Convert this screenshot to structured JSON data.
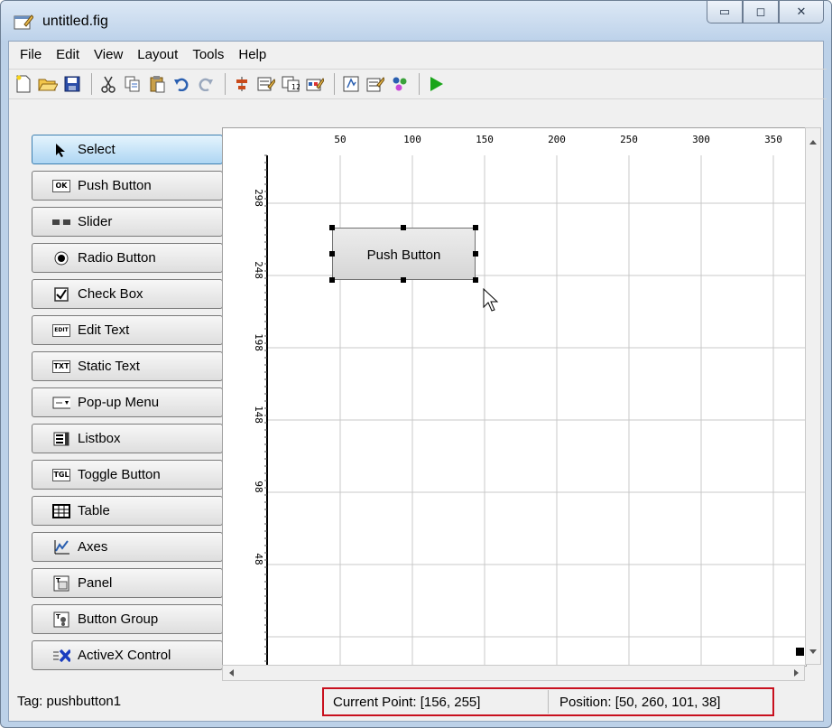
{
  "window": {
    "title": "untitled.fig",
    "min_glyph": "▭",
    "max_glyph": "◻",
    "close_glyph": "✕"
  },
  "menu": [
    "File",
    "Edit",
    "View",
    "Layout",
    "Tools",
    "Help"
  ],
  "toolbar_icons": [
    "new-icon",
    "open-icon",
    "save-icon",
    "sep",
    "cut-icon",
    "copy-icon",
    "paste-icon",
    "undo-icon",
    "redo-icon",
    "sep",
    "align-icon",
    "menu-editor-icon",
    "tab-order-icon",
    "toolbar-editor-icon",
    "sep",
    "mfile-editor-icon",
    "property-inspector-icon",
    "object-browser-icon",
    "sep",
    "run-icon"
  ],
  "palette": [
    {
      "label": "Select",
      "icon": "arrow-icon",
      "selected": true
    },
    {
      "label": "Push Button",
      "icon": "pushbutton-icon",
      "glyph": "OK"
    },
    {
      "label": "Slider",
      "icon": "slider-icon"
    },
    {
      "label": "Radio Button",
      "icon": "radio-icon"
    },
    {
      "label": "Check Box",
      "icon": "checkbox-icon"
    },
    {
      "label": "Edit Text",
      "icon": "edittext-icon",
      "glyph": "EDIT"
    },
    {
      "label": "Static Text",
      "icon": "statictext-icon",
      "glyph": "TXT"
    },
    {
      "label": "Pop-up Menu",
      "icon": "popup-icon"
    },
    {
      "label": "Listbox",
      "icon": "listbox-icon"
    },
    {
      "label": "Toggle Button",
      "icon": "toggle-icon",
      "glyph": "TGL"
    },
    {
      "label": "Table",
      "icon": "table-icon"
    },
    {
      "label": "Axes",
      "icon": "axes-icon"
    },
    {
      "label": "Panel",
      "icon": "panel-icon"
    },
    {
      "label": "Button Group",
      "icon": "buttongroup-icon"
    },
    {
      "label": "ActiveX Control",
      "icon": "activex-icon"
    }
  ],
  "ruler_top": [
    "50",
    "100",
    "150",
    "200",
    "250",
    "300",
    "350"
  ],
  "ruler_left": [
    "298",
    "248",
    "198",
    "148",
    "98",
    "48"
  ],
  "canvas_button": {
    "label": "Push Button"
  },
  "status": {
    "tag": "Tag: pushbutton1",
    "current_point": "Current Point:  [156, 255]",
    "position": "Position: [50, 260, 101, 38]"
  },
  "colors": {
    "highlight": "#c8101e",
    "selected": "#aed6f3",
    "run": "#1aa51a"
  }
}
